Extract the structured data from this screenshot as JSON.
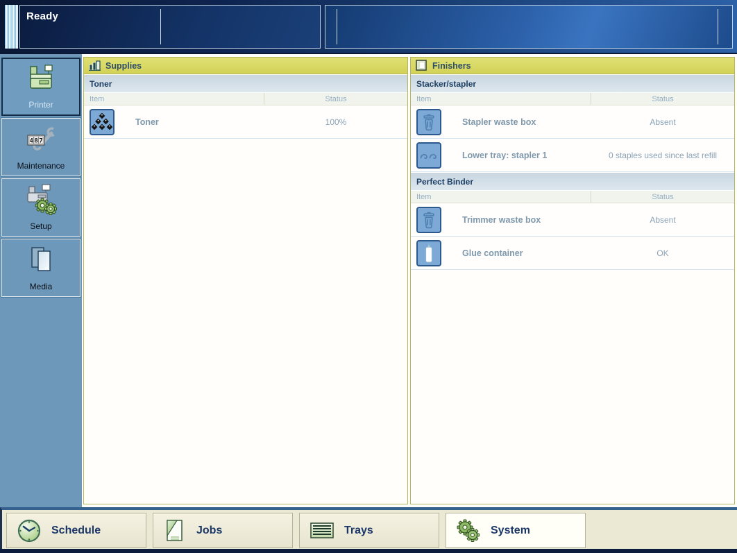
{
  "colors": {
    "topbar_navy": "#0d2148",
    "topbar_blue": "#2d62a9",
    "sidebar_blue": "#6d98ba",
    "panel_header_yellow": "#d8d863",
    "panel_border_olive": "#b5b55c",
    "section_band_blue": "#cdd9e2",
    "tabbar_beige": "#ebe8d4",
    "selected_tab_white": "#fffef7",
    "text_navy": "#1b3768",
    "text_steel_blue": "#7e98ac"
  },
  "titlebar": {
    "status": "Ready"
  },
  "sidebar": {
    "counter_digits": "487",
    "items": [
      {
        "label": "Printer",
        "icon": "printer-icon",
        "selected": true
      },
      {
        "label": "Maintenance",
        "icon": "maintenance-counter-icon",
        "selected": false
      },
      {
        "label": "Setup",
        "icon": "setup-icon",
        "selected": false
      },
      {
        "label": "Media",
        "icon": "media-icon",
        "selected": false
      }
    ]
  },
  "panels": [
    {
      "title": "Supplies",
      "icon": "supplies-chart-icon",
      "sections": [
        {
          "name": "Toner",
          "columns": [
            "Item",
            "Status"
          ],
          "rows": [
            {
              "icon": "toner-icon",
              "item": "Toner",
              "status": "100%"
            }
          ]
        }
      ]
    },
    {
      "title": "Finishers",
      "icon": "finishers-icon",
      "sections": [
        {
          "name": "Stacker/stapler",
          "columns": [
            "Item",
            "Status"
          ],
          "rows": [
            {
              "icon": "waste-box-icon",
              "item": "Stapler waste box",
              "status": "Absent"
            },
            {
              "icon": "stapler-icon",
              "item": "Lower tray: stapler 1",
              "status": "0 staples used since last refill"
            }
          ]
        },
        {
          "name": "Perfect Binder",
          "columns": [
            "Item",
            "Status"
          ],
          "rows": [
            {
              "icon": "waste-box-icon",
              "item": "Trimmer waste box",
              "status": "Absent"
            },
            {
              "icon": "glue-container-icon",
              "item": "Glue container",
              "status": "OK"
            }
          ]
        }
      ]
    }
  ],
  "tabbar": {
    "tabs": [
      {
        "label": "Schedule",
        "icon": "clock-icon",
        "selected": false
      },
      {
        "label": "Jobs",
        "icon": "jobs-document-icon",
        "selected": false
      },
      {
        "label": "Trays",
        "icon": "trays-icon",
        "selected": false
      },
      {
        "label": "System",
        "icon": "system-gears-icon",
        "selected": true
      }
    ]
  }
}
